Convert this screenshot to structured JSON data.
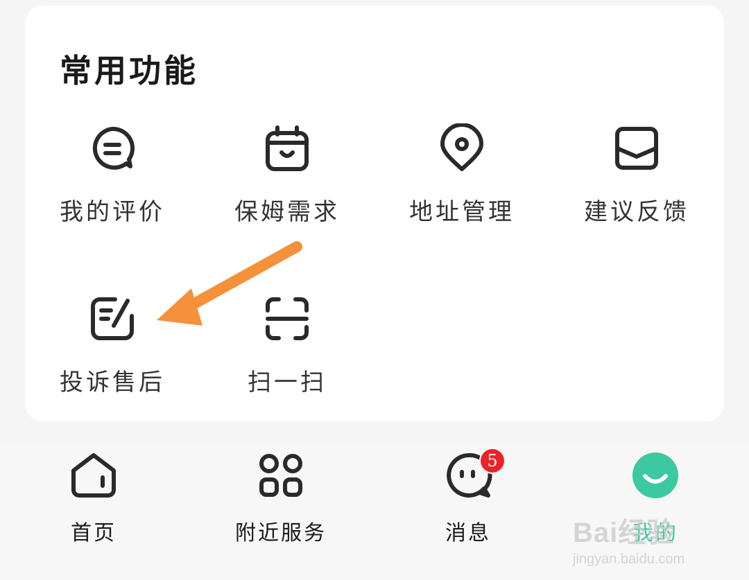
{
  "section": {
    "title": "常用功能"
  },
  "functions": [
    {
      "label": "我的评价",
      "icon": "comment-icon"
    },
    {
      "label": "保姆需求",
      "icon": "nanny-icon"
    },
    {
      "label": "地址管理",
      "icon": "location-pin-icon"
    },
    {
      "label": "建议反馈",
      "icon": "feedback-inbox-icon"
    },
    {
      "label": "投诉售后",
      "icon": "complaint-edit-icon"
    },
    {
      "label": "扫一扫",
      "icon": "scan-icon"
    }
  ],
  "annotation": {
    "color": "#f5913a",
    "target": "投诉售后"
  },
  "tabbar": {
    "tabs": [
      {
        "label": "首页",
        "icon": "home-icon"
      },
      {
        "label": "附近服务",
        "icon": "grid-icon"
      },
      {
        "label": "消息",
        "icon": "message-icon",
        "badge": "5"
      },
      {
        "label": "我的",
        "icon": "smile-avatar-icon",
        "active": true
      }
    ]
  },
  "watermark": {
    "brand": "Bai经验",
    "url": "jingyan.baidu.com"
  },
  "colors": {
    "accent": "#3cc8a0",
    "badge": "#e8232a",
    "arrow": "#f5913a"
  }
}
